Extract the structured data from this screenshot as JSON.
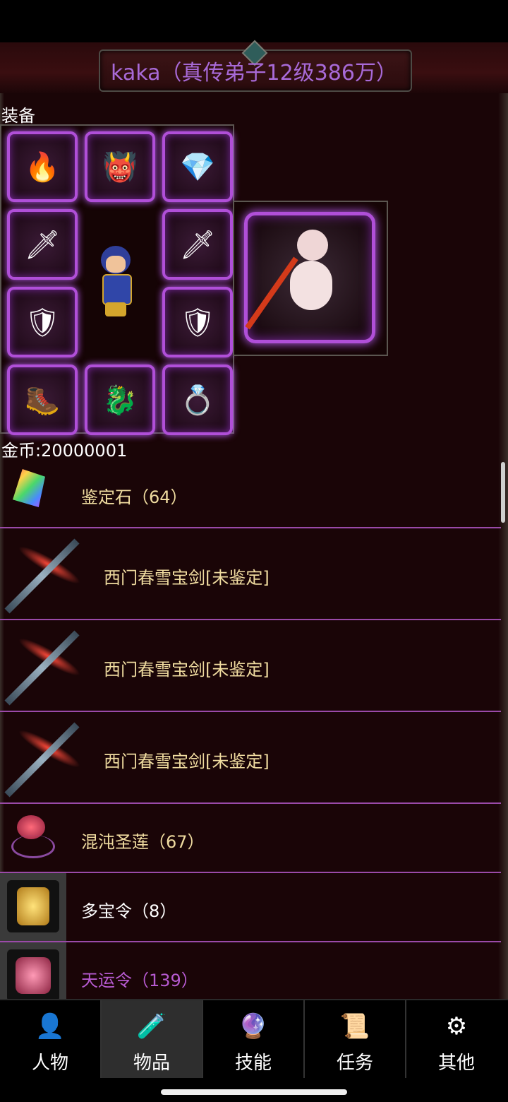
{
  "header": {
    "title": "kaka（真传弟子12级386万）"
  },
  "equipment": {
    "label": "装备",
    "slots": [
      {
        "name": "helmet",
        "icon": "🔥"
      },
      {
        "name": "armor",
        "icon": "👹"
      },
      {
        "name": "necklace",
        "icon": "💎"
      },
      {
        "name": "weapon-left",
        "icon": "🗡"
      },
      {
        "name": "weapon-right",
        "icon": "🗡"
      },
      {
        "name": "bracer-left",
        "icon": "🛡"
      },
      {
        "name": "bracer-right",
        "icon": "🛡"
      },
      {
        "name": "boots",
        "icon": "🥾"
      },
      {
        "name": "belt",
        "icon": "🐉"
      },
      {
        "name": "ring",
        "icon": "💍"
      }
    ]
  },
  "gold": {
    "text": "金币:20000001"
  },
  "inventory": [
    {
      "label": "鉴定石（64）",
      "color": "#f0dca0"
    },
    {
      "label": "西门春雪宝剑[未鉴定]",
      "color": "#f0dca0"
    },
    {
      "label": "西门春雪宝剑[未鉴定]",
      "color": "#f0dca0"
    },
    {
      "label": "西门春雪宝剑[未鉴定]",
      "color": "#f0dca0"
    },
    {
      "label": "混沌圣莲（67）",
      "color": "#f0dca0"
    },
    {
      "label": "多宝令（8）",
      "color": "#ffffff"
    },
    {
      "label": "天运令（139）",
      "color": "#b65ad0"
    }
  ],
  "tabs": [
    {
      "label": "人物",
      "icon": "👤",
      "active": false
    },
    {
      "label": "物品",
      "icon": "🧪",
      "active": true
    },
    {
      "label": "技能",
      "icon": "🔮",
      "active": false
    },
    {
      "label": "任务",
      "icon": "📜",
      "active": false
    },
    {
      "label": "其他",
      "icon": "⚙",
      "active": false
    }
  ]
}
